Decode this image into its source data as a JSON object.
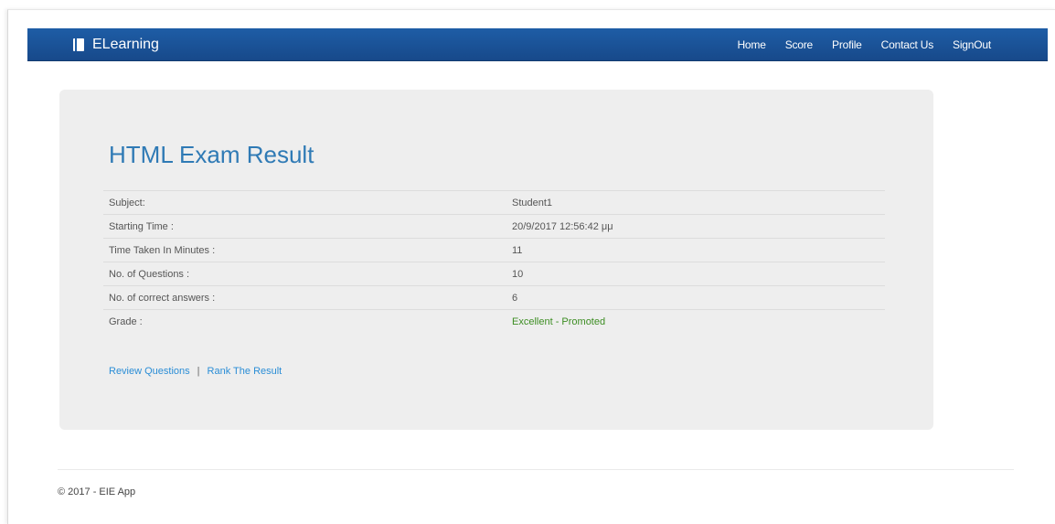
{
  "navbar": {
    "brand": "ELearning",
    "links": [
      "Home",
      "Score",
      "Profile",
      "Contact Us",
      "SignOut"
    ]
  },
  "result": {
    "title": "HTML Exam Result",
    "rows": [
      {
        "label": "Subject:",
        "value": "Student1"
      },
      {
        "label": "Starting Time :",
        "value": "20/9/2017 12:56:42 μμ"
      },
      {
        "label": "Time Taken In Minutes :",
        "value": "11"
      },
      {
        "label": "No. of Questions :",
        "value": "10"
      },
      {
        "label": "No. of correct answers :",
        "value": "6"
      },
      {
        "label": "Grade :",
        "value": "Excellent - Promoted"
      }
    ],
    "grade_color": "#3c8d22"
  },
  "actions": {
    "review": "Review Questions",
    "separator": "|",
    "rank": "Rank The Result"
  },
  "footer": {
    "text": "© 2017 - EIE App"
  },
  "colors": {
    "navbar": "#1e5da6",
    "title": "#2f7ab5",
    "link": "#2a8dd6",
    "panel": "#eeeeee"
  }
}
